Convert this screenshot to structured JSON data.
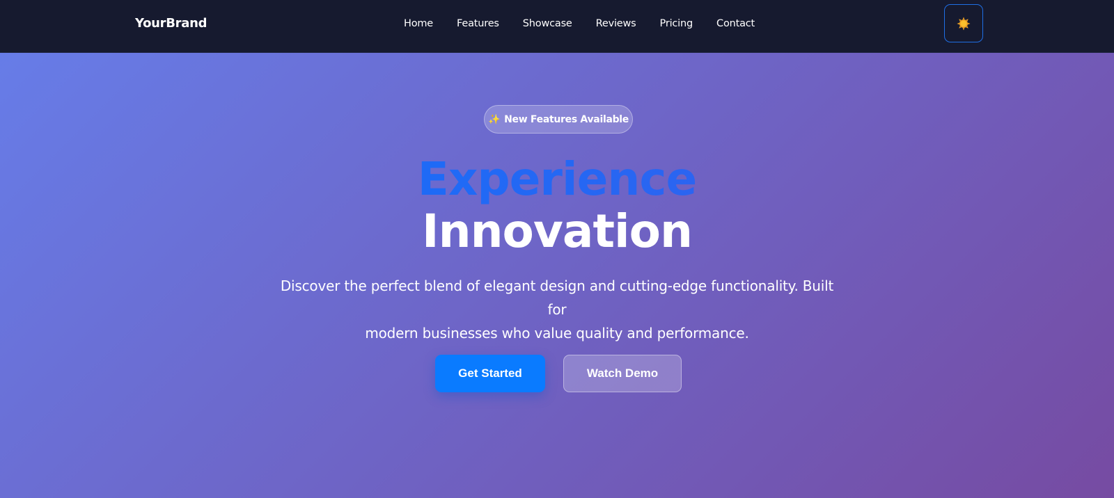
{
  "navbar": {
    "brand": "YourBrand",
    "links": [
      {
        "label": "Home"
      },
      {
        "label": "Features"
      },
      {
        "label": "Showcase"
      },
      {
        "label": "Reviews"
      },
      {
        "label": "Pricing"
      },
      {
        "label": "Contact"
      }
    ],
    "theme_toggle_icon": "sun-icon"
  },
  "hero": {
    "badge": {
      "icon": "sparkle-icon",
      "icon_glyph": "✨",
      "label": "New Features Available"
    },
    "headline_line1": "Experience",
    "headline_line2": "Innovation",
    "subtitle_line1": "Discover the perfect blend of elegant design and cutting-edge functionality. Built for",
    "subtitle_line2": "modern businesses who value quality and performance.",
    "primary_button": "Get Started",
    "secondary_button": "Watch Demo"
  },
  "colors": {
    "navbar_bg": "#161a2f",
    "hero_gradient_start": "#667eea",
    "hero_gradient_end": "#764ba2",
    "accent_blue": "#0a7bff",
    "headline_gradient_start": "#0a74ff",
    "headline_gradient_end": "#3f5be8",
    "toggle_border": "#1f6fe6",
    "sun": "#f5a623"
  }
}
